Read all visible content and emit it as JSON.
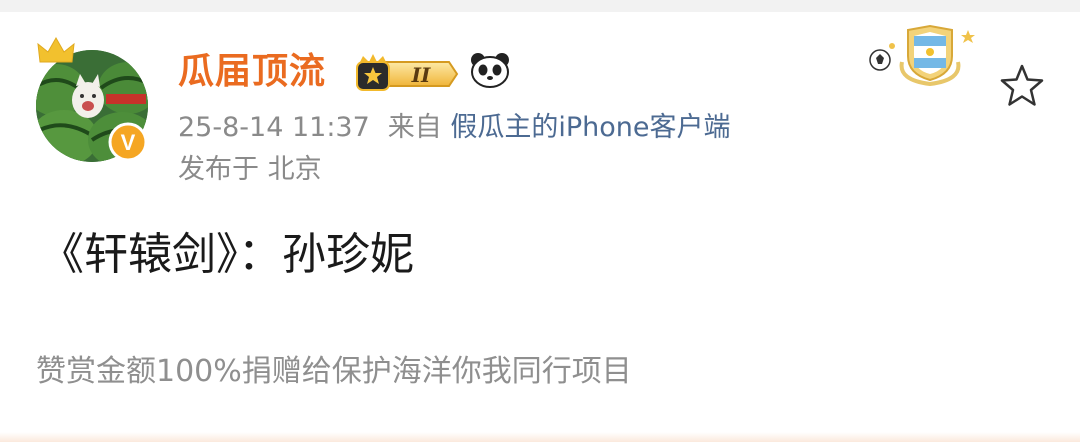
{
  "post": {
    "author": {
      "name": "瓜届顶流",
      "vip_badge": "II",
      "verified_badge": "V",
      "avatar_icon": "watermelon-cat-avatar"
    },
    "meta": {
      "time": "25-8-14 11:37",
      "from_prefix": "来自",
      "client": "假瓜主的iPhone客户端",
      "location": "发布于 北京"
    },
    "content": "《轩辕剑》：孙珍妮",
    "footer_note": "赞赏金额100%捐赠给保护海洋你我同行项目"
  },
  "colors": {
    "username": "#ea6b20",
    "client_link": "#4c6a92",
    "meta": "#8a8a8a",
    "content": "#1a1a1a"
  }
}
